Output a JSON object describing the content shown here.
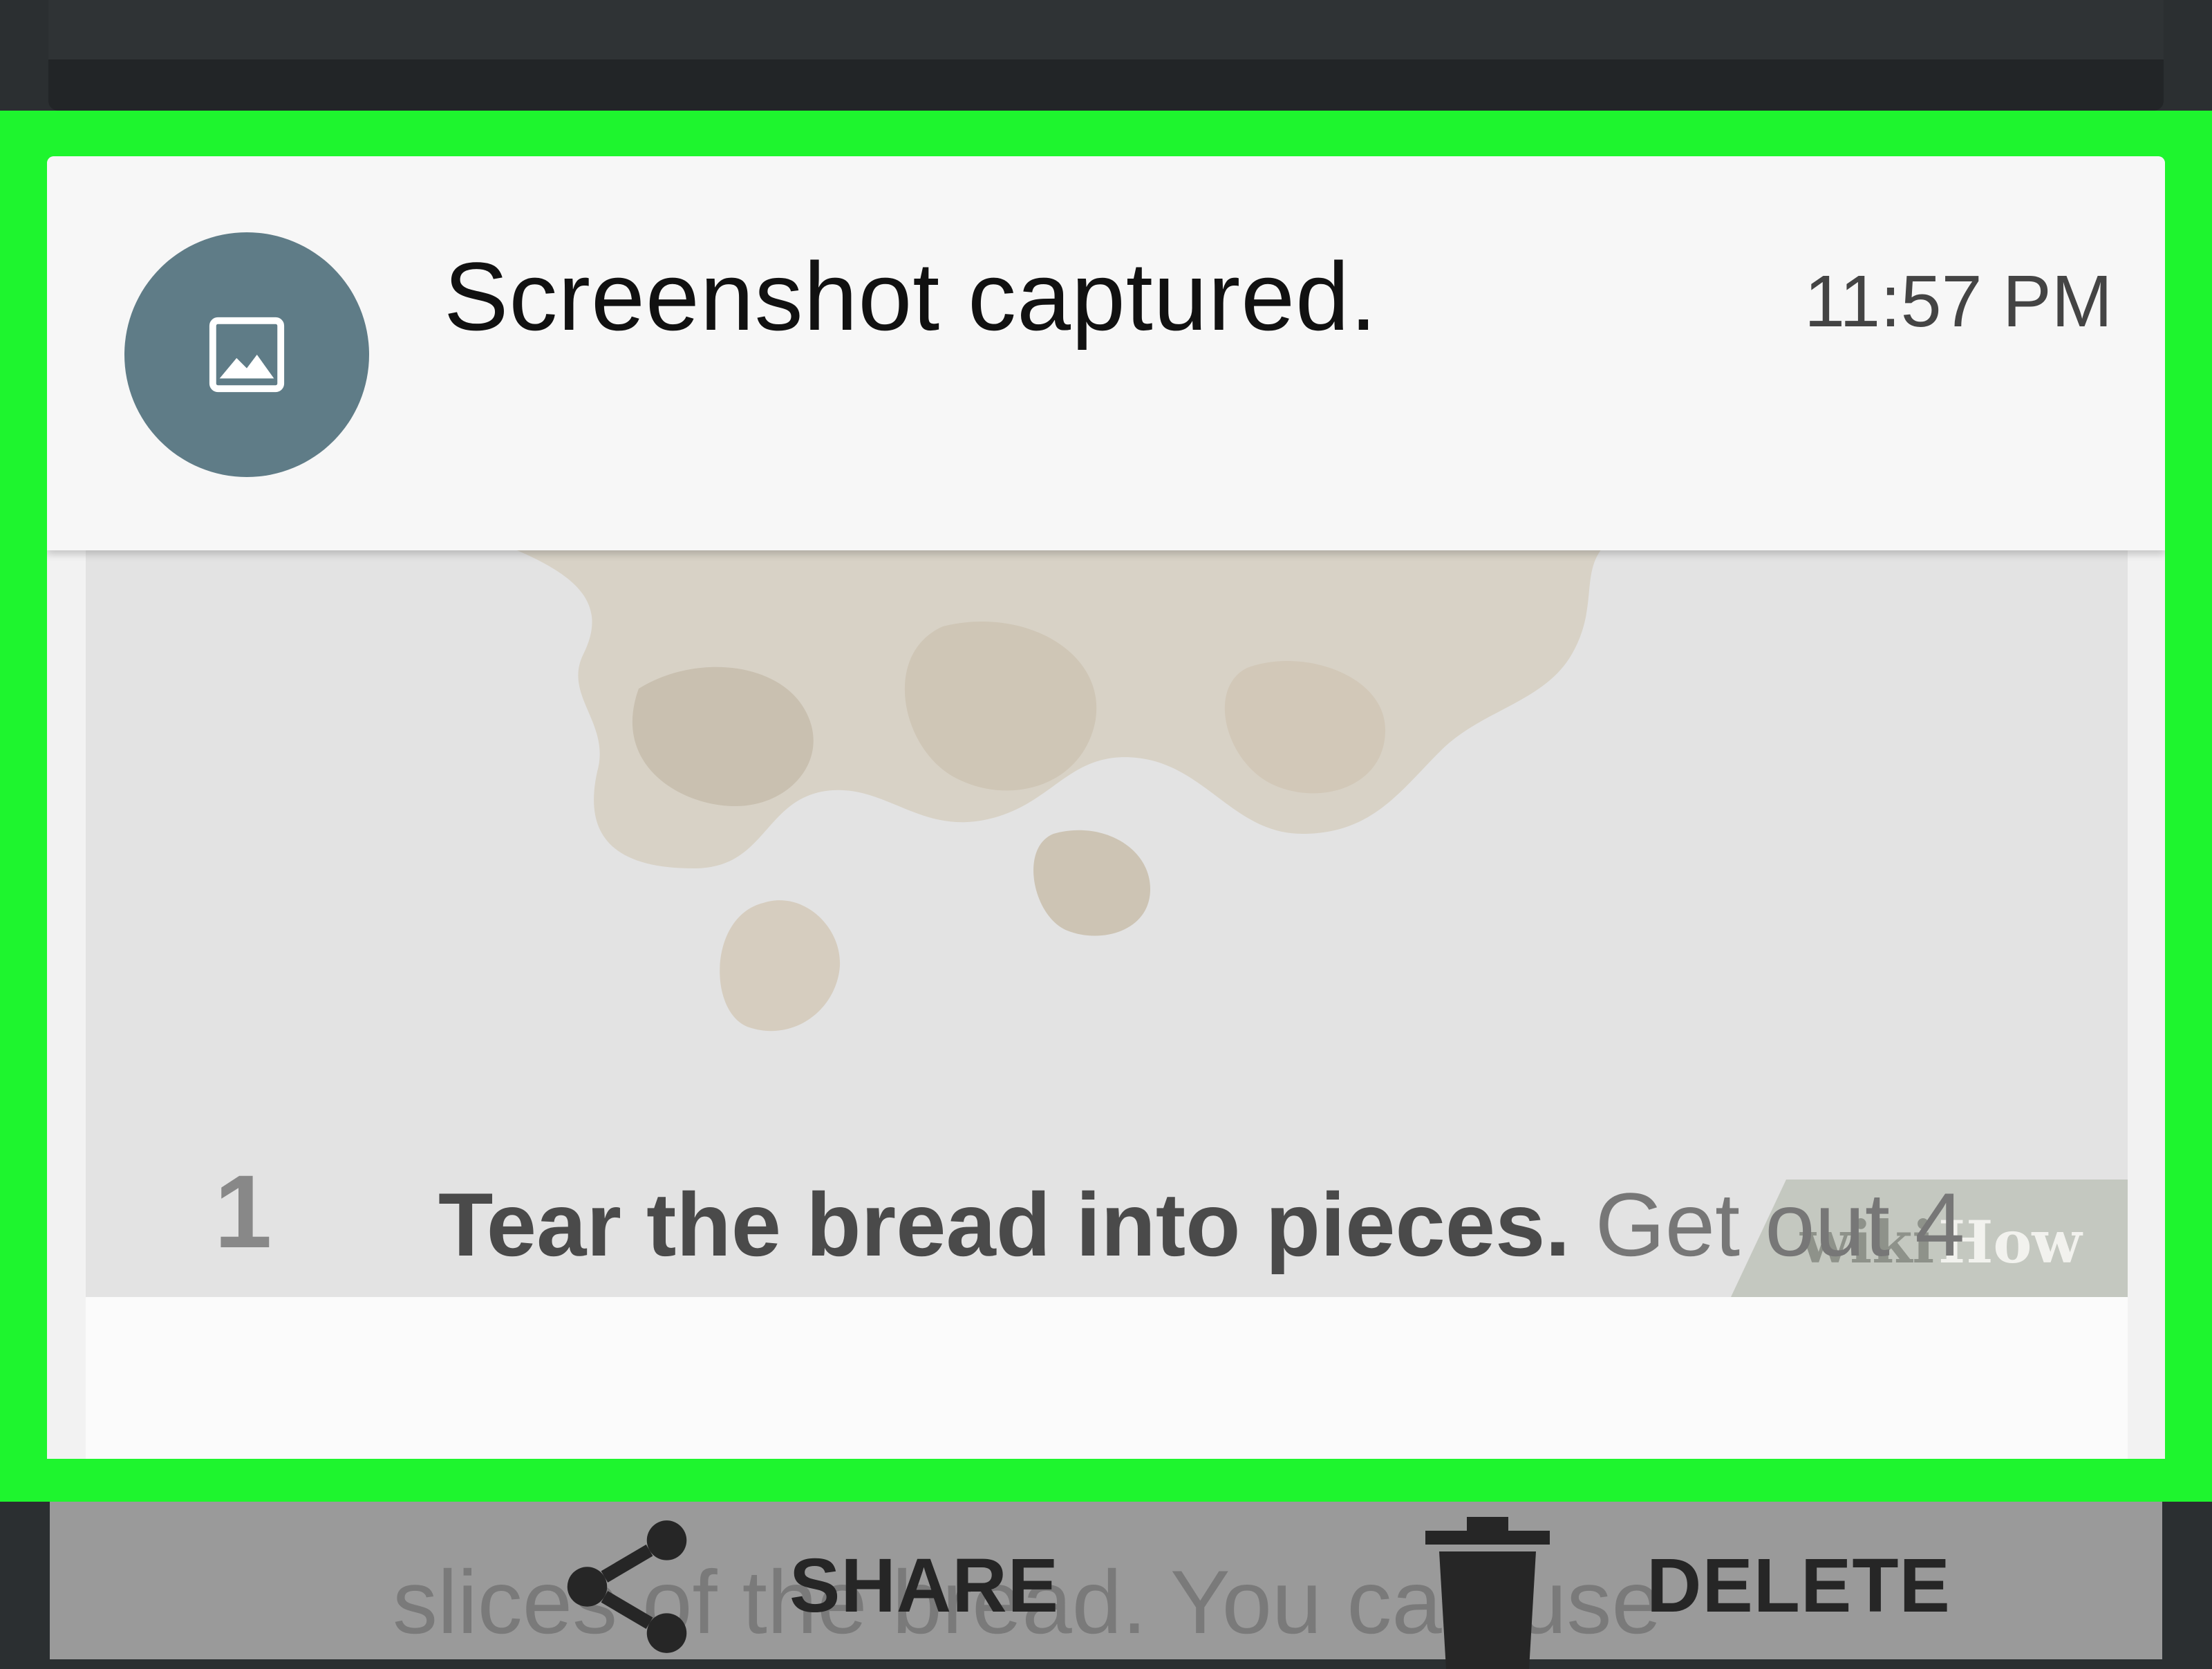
{
  "notification": {
    "title": "Screenshot captured.",
    "time": "11:57 PM",
    "icon": "image-icon"
  },
  "preview": {
    "watermark_left": "wiki",
    "watermark_right": "How",
    "step_number": "1",
    "step_bold": "Tear the bread into pieces.",
    "step_rest": " Get out 4",
    "step_line2": "slices of the bread. You can use"
  },
  "actions": {
    "share_label": "SHARE",
    "share_icon": "share-icon",
    "delete_label": "DELETE",
    "delete_icon": "trash-icon"
  },
  "colors": {
    "highlight": "#1ef52e",
    "avatar": "#5f7c87",
    "card": "#f7f7f7"
  }
}
